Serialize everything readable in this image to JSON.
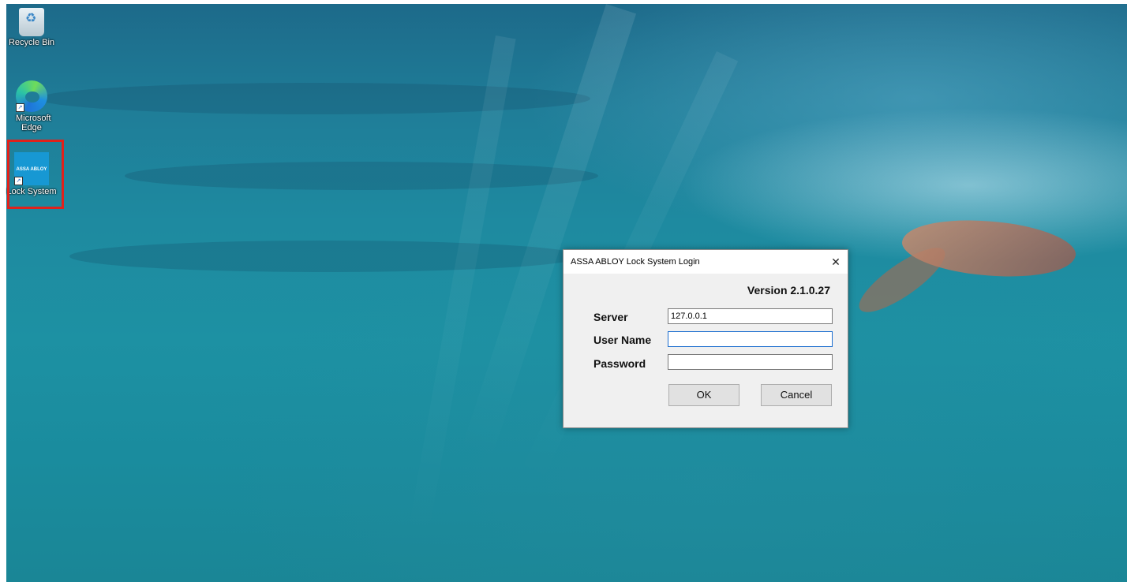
{
  "desktop": {
    "icons": [
      {
        "label": "Recycle Bin",
        "icon": "recycle-bin-icon"
      },
      {
        "label": "Microsoft Edge",
        "icon": "edge-icon"
      },
      {
        "label": "Lock System",
        "icon": "assa-abloy-icon",
        "brand_text": "ASSA ABLOY"
      }
    ],
    "highlight_color": "#e0211b"
  },
  "dialog": {
    "title": "ASSA ABLOY Lock System Login",
    "close_glyph": "✕",
    "version": "Version 2.1.0.27",
    "server_label": "Server",
    "server_value": "127.0.0.1",
    "username_label": "User Name",
    "username_value": "",
    "password_label": "Password",
    "password_value": "",
    "ok_label": "OK",
    "cancel_label": "Cancel"
  }
}
